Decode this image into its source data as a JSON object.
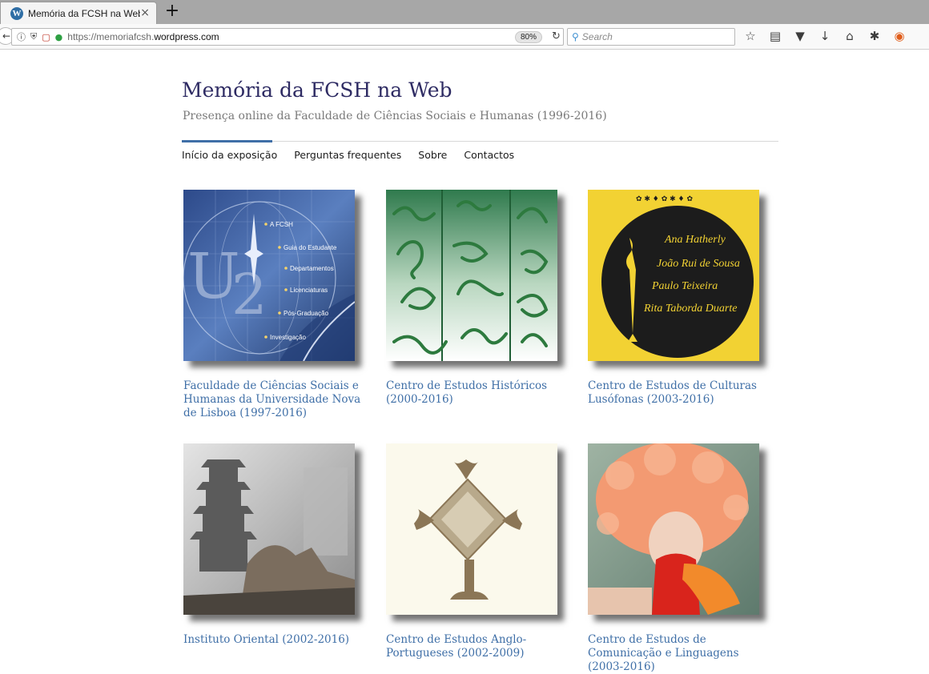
{
  "browser": {
    "tab_title": "Memória da FCSH na Web –",
    "tab_close": "×",
    "new_tab": "+",
    "url_prefix": "https://memoriafcsh.",
    "url_domain": "wordpress.com",
    "zoom": "80%",
    "search_placeholder": "Search"
  },
  "site": {
    "title": "Memória da FCSH na Web",
    "description": "Presença online da Faculdade de Ciências Sociais e Humanas (1996-2016)"
  },
  "menu": [
    {
      "label": "Início da exposição",
      "active": true
    },
    {
      "label": "Perguntas frequentes",
      "active": false
    },
    {
      "label": "Sobre",
      "active": false
    },
    {
      "label": "Contactos",
      "active": false
    }
  ],
  "cards": [
    {
      "caption": "Faculdade de Ciências Sociais e Humanas da Universidade Nova de Lisboa (1997-2016)",
      "image_labels": [
        "A FCSH",
        "Guia do Estudante",
        "Departamentos",
        "Licenciaturas",
        "Pós-Graduação",
        "Investigação"
      ]
    },
    {
      "caption": "Centro de Estudos Históricos (2000-2016)"
    },
    {
      "caption": "Centro de Estudos de Culturas Lusófonas (2003-2016)",
      "image_labels": [
        "Ana Hatherly",
        "João Rui de Sousa",
        "Paulo Teixeira",
        "Rita Taborda Duarte"
      ]
    },
    {
      "caption": "Instituto Oriental (2002-2016)"
    },
    {
      "caption": "Centro de Estudos Anglo-Portugueses (2002-2009)"
    },
    {
      "caption": "Centro de Estudos de Comunicação e Linguagens (2003-2016)"
    }
  ],
  "colors": {
    "title": "#2e2b63",
    "link": "#3f6fa7",
    "accent": "#3f6fa7"
  }
}
